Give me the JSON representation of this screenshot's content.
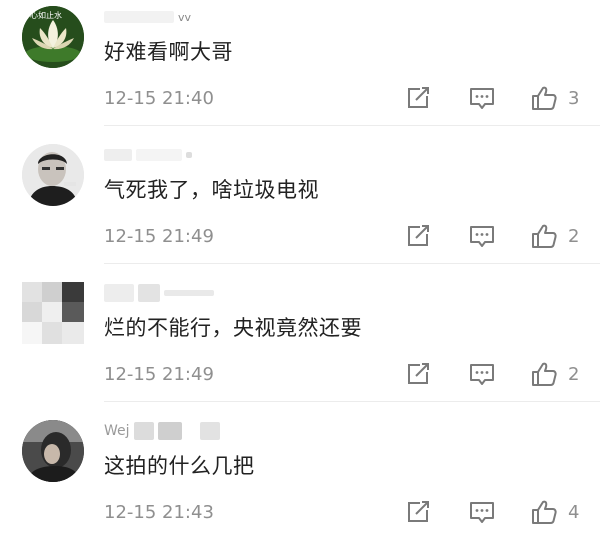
{
  "comments": [
    {
      "username": "vv",
      "avatar_label": "心如止水",
      "text": "好难看啊大哥",
      "time": "12-15 21:40",
      "likes": "3"
    },
    {
      "username": "",
      "avatar_label": "",
      "text": "气死我了，啥垃圾电视",
      "time": "12-15 21:49",
      "likes": "2"
    },
    {
      "username": "",
      "avatar_label": "",
      "text": "烂的不能行，央视竟然还要",
      "time": "12-15 21:49",
      "likes": "2"
    },
    {
      "username": "Wej",
      "avatar_label": "",
      "text": "这拍的什么几把",
      "time": "12-15 21:43",
      "likes": "4"
    }
  ],
  "icons": {
    "share": "share-icon",
    "reply": "comment-icon",
    "like": "thumbs-up-icon"
  },
  "colors": {
    "text": "#222222",
    "meta": "#8f8f8f",
    "icon": "#7a7a7a"
  }
}
